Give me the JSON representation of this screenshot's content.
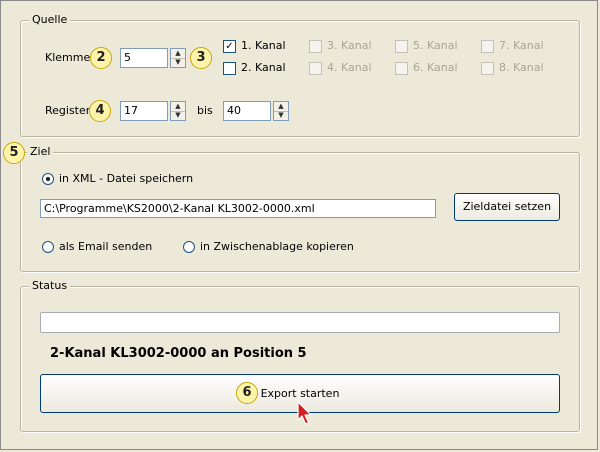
{
  "quelle": {
    "legend": "Quelle",
    "klemme_label": "Klemme",
    "klemme_value": "5",
    "register_label": "Register",
    "register_from": "17",
    "bis_label": "bis",
    "register_to": "40",
    "channels": [
      {
        "label": "1. Kanal",
        "checked": true,
        "enabled": true
      },
      {
        "label": "2. Kanal",
        "checked": false,
        "enabled": true
      },
      {
        "label": "3. Kanal",
        "checked": false,
        "enabled": false
      },
      {
        "label": "4. Kanal",
        "checked": false,
        "enabled": false
      },
      {
        "label": "5. Kanal",
        "checked": false,
        "enabled": false
      },
      {
        "label": "6. Kanal",
        "checked": false,
        "enabled": false
      },
      {
        "label": "7. Kanal",
        "checked": false,
        "enabled": false
      },
      {
        "label": "8. Kanal",
        "checked": false,
        "enabled": false
      }
    ]
  },
  "ziel": {
    "legend": "Ziel",
    "option_xml": "in XML - Datei speichern",
    "file_path": "C:\\Programme\\KS2000\\2-Kanal KL3002-0000.xml",
    "set_target_button": "Zieldatei setzen",
    "option_email": "als Email senden",
    "option_clipboard": "in Zwischenablage kopieren",
    "selected": "xml"
  },
  "status": {
    "legend": "Status",
    "progress": 0,
    "message": "2-Kanal KL3002-0000 an Position 5",
    "export_button": "Export starten"
  },
  "badges": {
    "b2": "2",
    "b3": "3",
    "b4": "4",
    "b5": "5",
    "b6": "6"
  },
  "colors": {
    "window_bg": "#ece9d8",
    "badge_fill": "#fff3a8",
    "cursor_red": "#d42020"
  }
}
